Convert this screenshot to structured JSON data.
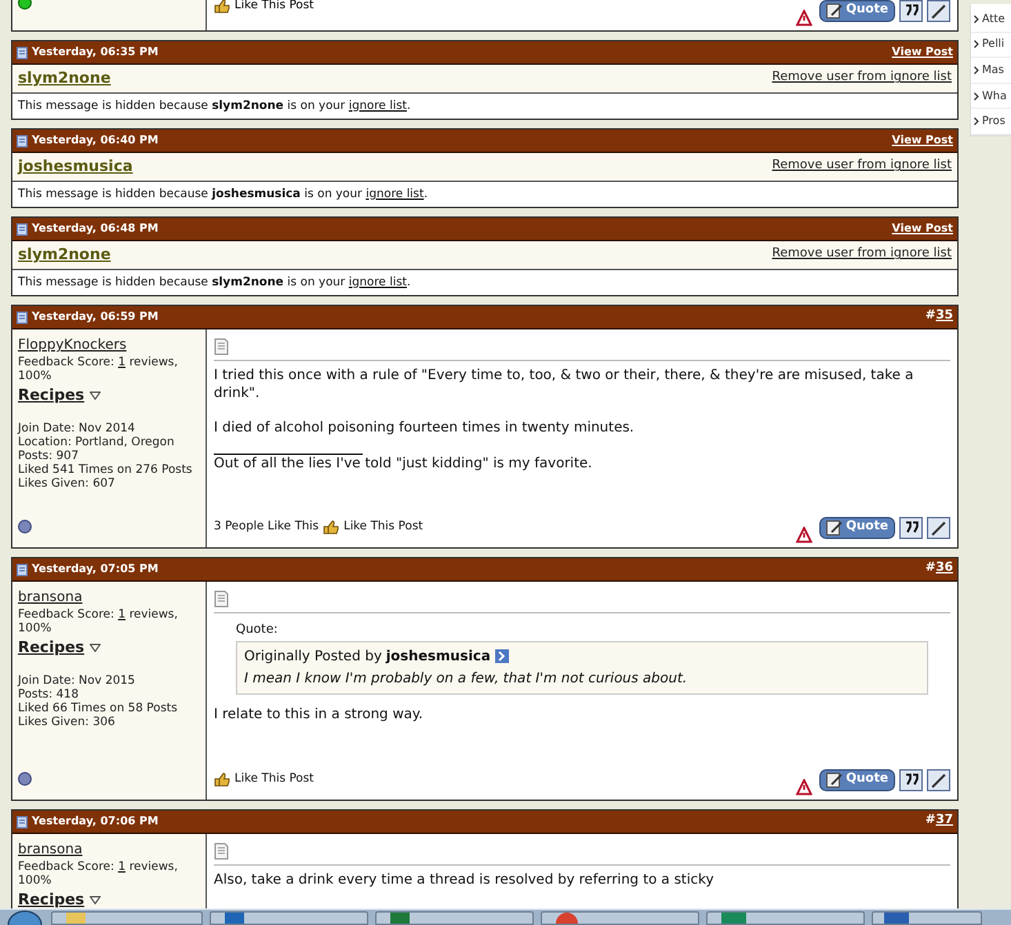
{
  "top_post": {
    "online": true,
    "like_label": "Like This Post",
    "quote_label": "Quote"
  },
  "sidebar": {
    "items": [
      "Atte",
      "Pelli",
      "Mas",
      "Wha",
      "Pros"
    ]
  },
  "posts": [
    {
      "kind": "ignored",
      "date": "Yesterday, 06:35 PM",
      "view_link": "View Post",
      "username": "slym2none",
      "remove_link": "Remove user from ignore list",
      "message": "This message is hidden because **slym2none** is on your",
      "message_link": "ignore list",
      "message_end": "."
    },
    {
      "kind": "ignored",
      "date": "Yesterday, 06:40 PM",
      "view_link": "View Post",
      "username": "joshesmusica",
      "remove_link": "Remove user from ignore list",
      "message": "This message is hidden because **joshesmusica** is on your",
      "message_link": "ignore list",
      "message_end": "."
    },
    {
      "kind": "ignored",
      "date": "Yesterday, 06:48 PM",
      "view_link": "View Post",
      "username": "slym2none",
      "remove_link": "Remove user from ignore list",
      "message": "This message is hidden because **slym2none** is on your",
      "message_link": "ignore list",
      "message_end": "."
    },
    {
      "kind": "post",
      "date": "Yesterday, 06:59 PM",
      "number_prefix": "#",
      "number": "35",
      "author": "FloppyKnockers",
      "feedback": "Feedback Score:",
      "feedback_link": "1",
      "feedback_end": "reviews, 100%",
      "group": "Recipes",
      "info": [
        "Join Date: Nov 2014",
        "Location: Portland, Oregon",
        "Posts: 907",
        "Liked 541 Times on 276 Posts",
        "Likes Given: 607"
      ],
      "online": false,
      "paragraphs": [
        "I tried this once with a rule of \"Every time to, too, & two or their, there, & they're are misused, take a drink\".",
        "I died of alcohol poisoning fourteen times in twenty minutes."
      ],
      "signature": [
        "Out of all the lies I've told \"just kidding\" is my favorite."
      ],
      "likes_count": "3 People Like This",
      "like_label": "Like This Post",
      "quote_label": "Quote"
    },
    {
      "kind": "post",
      "date": "Yesterday, 07:05 PM",
      "number_prefix": "#",
      "number": "36",
      "author": "bransona",
      "feedback": "Feedback Score:",
      "feedback_link": "1",
      "feedback_end": "reviews, 100%",
      "group": "Recipes",
      "info": [
        "Join Date: Nov 2015",
        "Posts: 418",
        "Liked 66 Times on 58 Posts",
        "Likes Given: 306"
      ],
      "online": false,
      "quote": {
        "label": "Quote:",
        "prefix": "Originally Posted by",
        "author": "joshesmusica",
        "text": "I mean I know I'm probably on a few, that I'm not curious about."
      },
      "paragraphs": [
        "I relate to this in a strong way."
      ],
      "like_label": "Like This Post",
      "quote_label": "Quote"
    },
    {
      "kind": "post",
      "date": "Yesterday, 07:06 PM",
      "number_prefix": "#",
      "number": "37",
      "author": "bransona",
      "feedback": "Feedback Score:",
      "feedback_link": "1",
      "feedback_end": "reviews, 100%",
      "group": "Recipes",
      "paragraphs": [
        "Also, take a drink every time a thread is resolved by referring to a sticky"
      ]
    }
  ]
}
